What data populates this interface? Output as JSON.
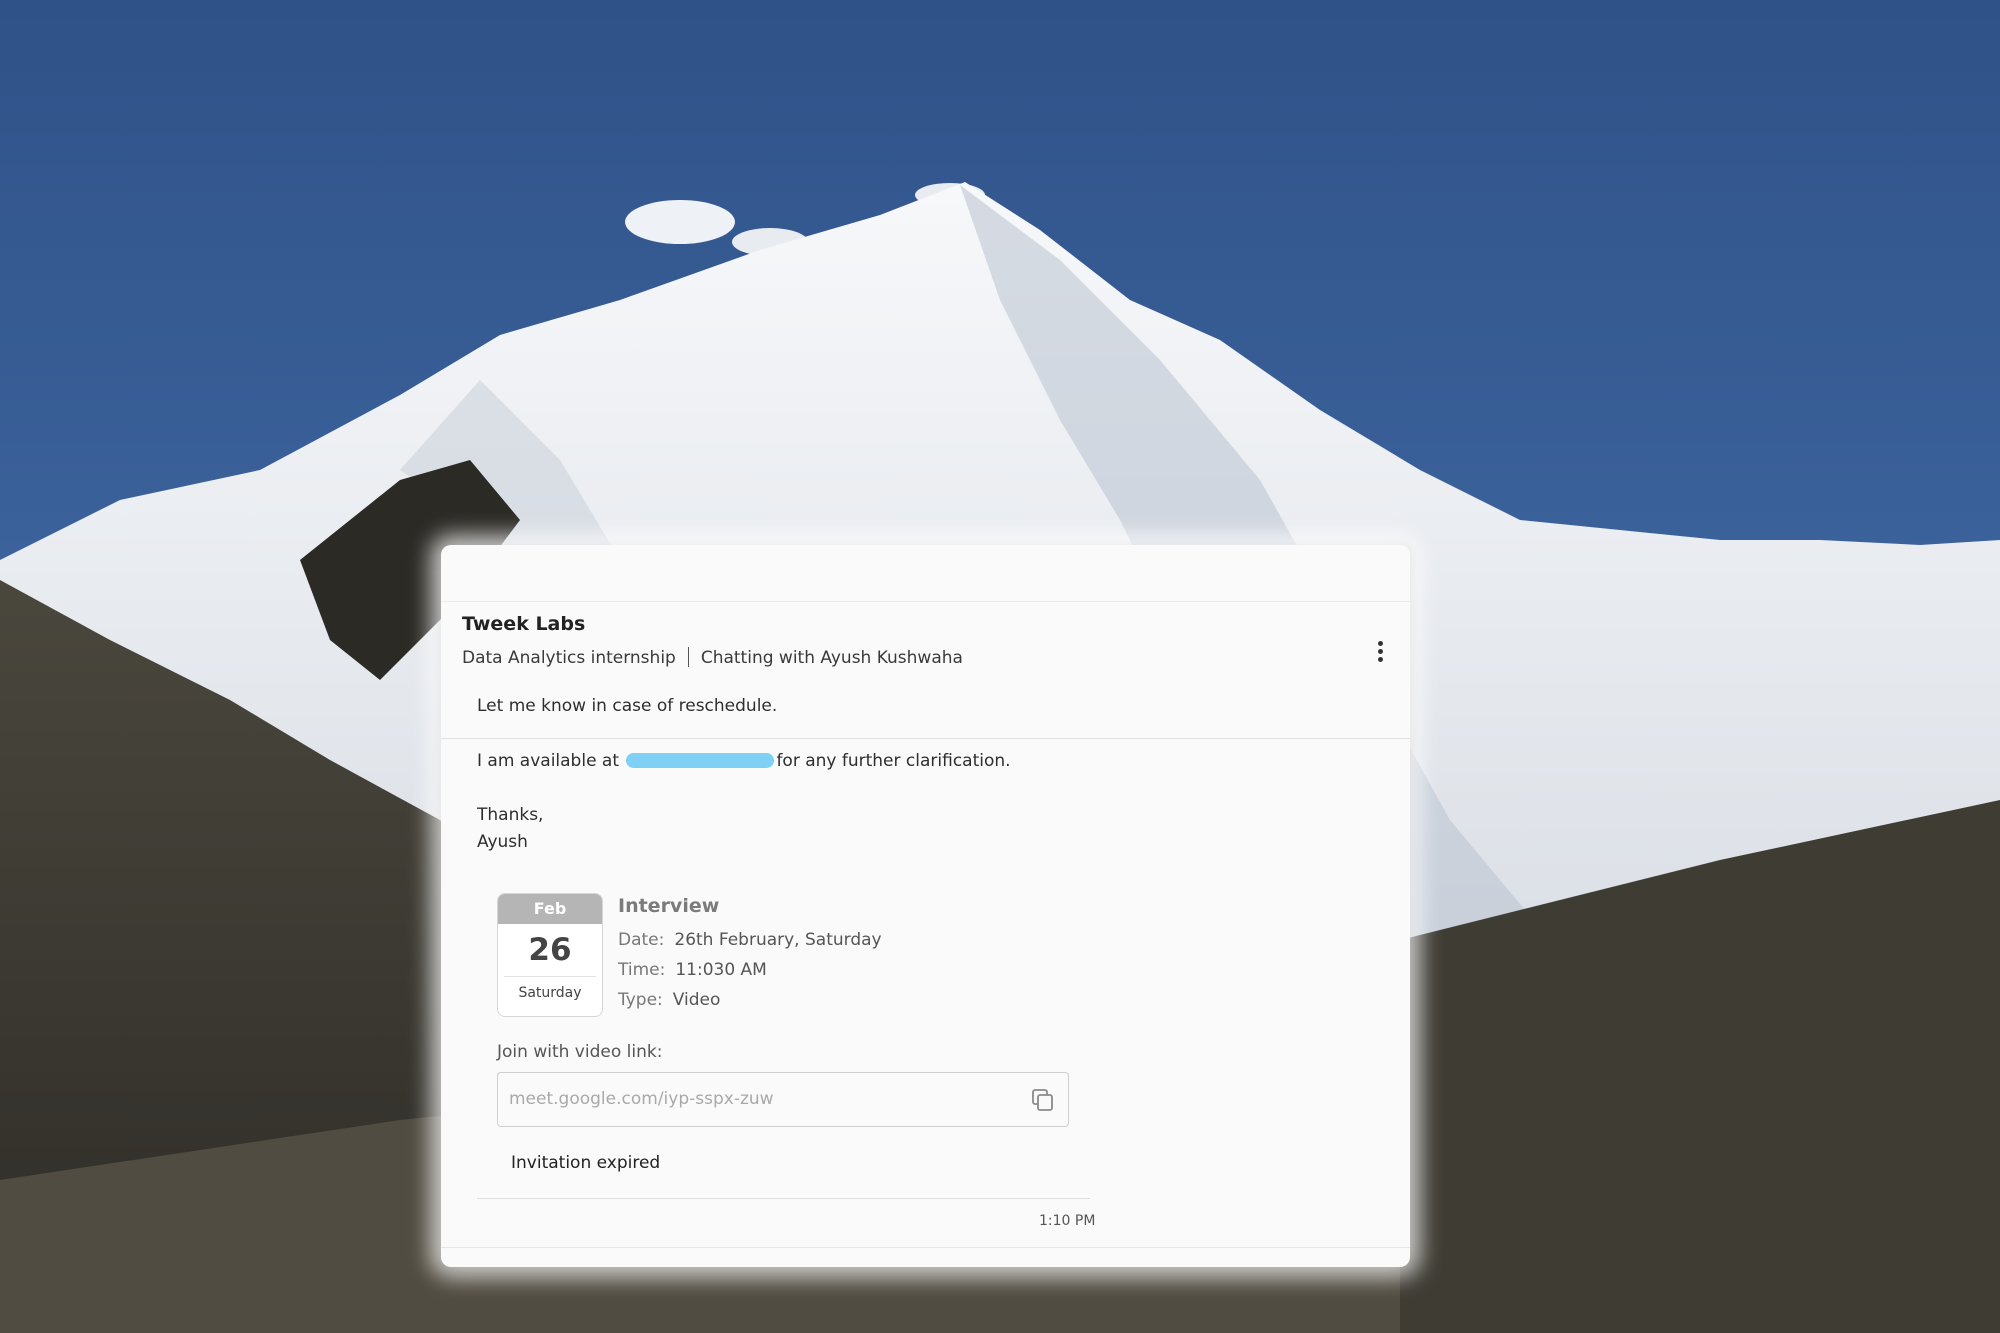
{
  "chat": {
    "company": "Tweek Labs",
    "role": "Data Analytics internship",
    "chatting_with": "Chatting with Ayush Kushwaha",
    "menu_icon": "more-vertical-icon"
  },
  "message": {
    "line1": "Let me know in case of reschedule.",
    "line2_before": "I am available at",
    "line2_after": "for any further clarification.",
    "signoff": "Thanks,",
    "signature": "Ayush"
  },
  "event": {
    "month": "Feb",
    "day": "26",
    "weekday": "Saturday",
    "title": "Interview",
    "date_label": "Date:",
    "date_value": "26th February, Saturday",
    "time_label": "Time:",
    "time_value": "11:030 AM",
    "type_label": "Type:",
    "type_value": "Video"
  },
  "join": {
    "label": "Join with video link:",
    "link": "meet.google.com/iyp-sspx-zuw",
    "copy_icon": "copy-icon"
  },
  "status": "Invitation expired",
  "timestamp": "1:10 PM",
  "colors": {
    "sky": "#36588f",
    "snow": "#eef1f4",
    "rock": "#3b3a34",
    "redaction": "#7fd0f5",
    "calendar_header": "#b5b5b5"
  }
}
